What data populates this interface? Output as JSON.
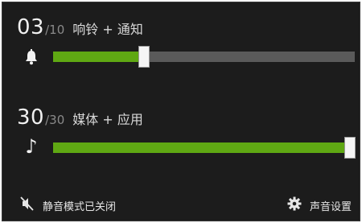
{
  "ringer": {
    "level_current": "03",
    "level_max": "/10",
    "label": "响铃 + 通知",
    "icon": "bell-icon",
    "fraction": 0.3
  },
  "media": {
    "level_current": "30",
    "level_max": "/30",
    "label": "媒体 + 应用",
    "icon": "music-note-icon",
    "note_glyph": "♪",
    "fraction": 1.0
  },
  "footer": {
    "silent_label": "静音模式已关闭",
    "silent_icon": "speaker-muted-icon",
    "settings_label": "声音设置",
    "settings_icon": "gear-icon"
  },
  "colors": {
    "panel_background": "#1c1c1c",
    "accent_green": "#5fa813",
    "track_gray": "#5a5a5a"
  }
}
